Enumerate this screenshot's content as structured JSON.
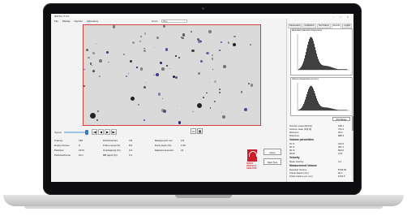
{
  "app": {
    "title": "WinVis v7.6.0",
    "window_controls": "–  □  ✕",
    "menu": [
      "File",
      "Display",
      "Capture",
      "Laboratory"
    ],
    "source_label": "Source",
    "source_value": "Files"
  },
  "playback": {
    "speed_label": "Speed",
    "buttons": [
      "|◀",
      "◀",
      "▶",
      "▶|"
    ],
    "view_buttons": [
      "▭",
      "▦"
    ]
  },
  "stats": {
    "rows": [
      {
        "label": "Frames",
        "value": "196"
      },
      {
        "label": "Empty frames",
        "value": "0"
      },
      {
        "label": "Particles",
        "value": "1974"
      },
      {
        "label": "Particles/frame",
        "value": "10.1"
      }
    ],
    "col2": [
      {
        "label": "Particles/Litre",
        "value": "3.8"
      },
      {
        "label": "Frame area (%)",
        "value": "8.6"
      },
      {
        "label": "Overlapping (%)",
        "value": "0.3"
      },
      {
        "label": "BB reject (%)",
        "value": "0.1"
      }
    ],
    "col3": [
      {
        "label": "Background mm",
        "value": "2.5"
      },
      {
        "label": "Dark pixels (%)",
        "value": "1.00"
      },
      {
        "label": "Elapsed seconds",
        "value": "21"
      }
    ]
  },
  "logo_text": "SOPAT\nPARTICLE\nANALYSIS",
  "actions": {
    "open": "Open",
    "start": "Start Test"
  },
  "panel": {
    "tabs": [
      "Parameters",
      "Calibration",
      "Test Status",
      "Results",
      "Logfile"
    ],
    "active_tab": "Results",
    "histogram1_title": "Equivalent diameter frequencies",
    "histogram2_title": "Volume frequencies (cumul.)",
    "plot_button": "Plot Range",
    "summary": [
      {
        "label": "Number mean (D[1,0])",
        "value": "136.1"
      },
      {
        "label": "Volume mean (D[4,3])",
        "value": "372.2"
      },
      {
        "label": "Minimum",
        "value": "25.0"
      },
      {
        "label": "Maximum",
        "value": "988.3"
      }
    ],
    "volume_percentiles_heading": "Volume percentiles",
    "volume_percentiles": [
      {
        "label": "10 %",
        "value": "152.0"
      },
      {
        "label": "50 %",
        "value": "357.1"
      },
      {
        "label": "90 %",
        "value": "604.0"
      },
      {
        "label": "90/10",
        "value": "3.97"
      }
    ],
    "velocity_heading": "Velocity",
    "velocity": [
      {
        "label": "Mean Velocity",
        "value": "4.2"
      }
    ],
    "measurement_heading": "Measurement Volume",
    "measurement": [
      {
        "label": "Detected Volume",
        "value": "5734.63"
      },
      {
        "label": "Frame Depth (mm)",
        "value": "22.4"
      },
      {
        "label": "Probe Volume (cu mm)",
        "value": "1373.5"
      }
    ]
  },
  "colors": {
    "accent": "#3d7ac0",
    "image_border": "#d04040",
    "logo": "#c9202b",
    "histogram_bars": "#111111"
  }
}
